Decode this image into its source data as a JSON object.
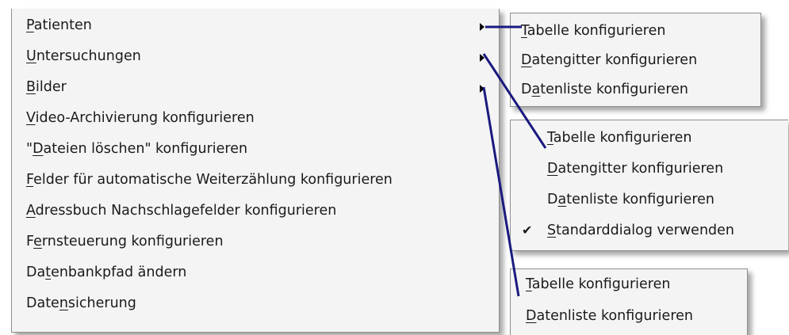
{
  "main_menu": {
    "items": [
      {
        "pre": "",
        "acc": "P",
        "post": "atienten",
        "has_submenu": true
      },
      {
        "pre": "",
        "acc": "U",
        "post": "ntersuchungen",
        "has_submenu": true
      },
      {
        "pre": "",
        "acc": "B",
        "post": "ilder",
        "has_submenu": true
      },
      {
        "pre": "",
        "acc": "V",
        "post": "ideo-Archivierung konfigurieren",
        "has_submenu": false
      },
      {
        "pre": "\"",
        "acc": "D",
        "post": "ateien löschen\" konfigurieren",
        "has_submenu": false
      },
      {
        "pre": "",
        "acc": "F",
        "post": "elder für automatische Weiterzählung konfigurieren",
        "has_submenu": false
      },
      {
        "pre": "",
        "acc": "A",
        "post": "dressbuch Nachschlagefelder konfigurieren",
        "has_submenu": false
      },
      {
        "pre": "F",
        "acc": "e",
        "post": "rnsteuerung konfigurieren",
        "has_submenu": false
      },
      {
        "pre": "Da",
        "acc": "t",
        "post": "enbankpfad ändern",
        "has_submenu": false
      },
      {
        "pre": "Date",
        "acc": "n",
        "post": "sicherung",
        "has_submenu": false
      }
    ]
  },
  "submenu_patienten": {
    "items": [
      {
        "pre": "",
        "acc": "T",
        "post": "abelle konfigurieren"
      },
      {
        "pre": "",
        "acc": "D",
        "post": "atengitter konfigurieren"
      },
      {
        "pre": "D",
        "acc": "a",
        "post": "tenliste konfigurieren"
      }
    ]
  },
  "submenu_untersuchungen": {
    "items": [
      {
        "pre": "",
        "acc": "T",
        "post": "abelle konfigurieren",
        "checked": false
      },
      {
        "pre": "",
        "acc": "D",
        "post": "atengitter konfigurieren",
        "checked": false
      },
      {
        "pre": "D",
        "acc": "a",
        "post": "tenliste konfigurieren",
        "checked": false
      },
      {
        "pre": "",
        "acc": "S",
        "post": "tandarddialog verwenden",
        "checked": true
      }
    ],
    "check_glyph": "✔"
  },
  "submenu_bilder": {
    "items": [
      {
        "pre": "",
        "acc": "T",
        "post": "abelle konfigurieren"
      },
      {
        "pre": "",
        "acc": "D",
        "post": "atenliste konfigurieren"
      }
    ]
  },
  "colors": {
    "connector": "#1a1a80",
    "menu_bg": "#f4f4f4"
  }
}
